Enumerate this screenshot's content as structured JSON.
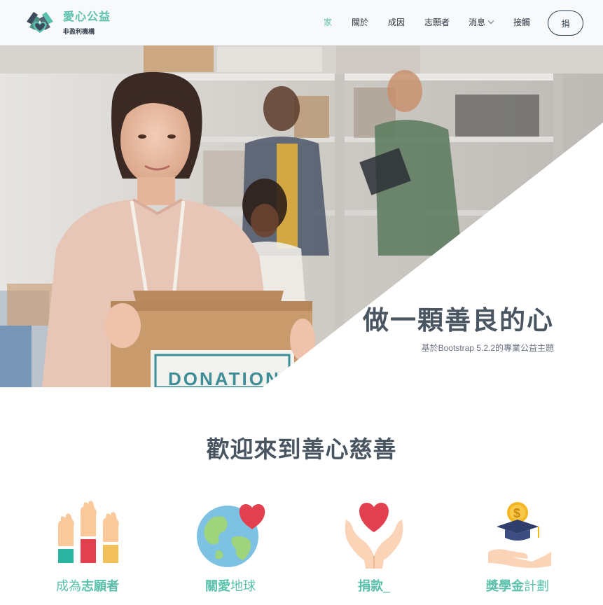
{
  "brand": {
    "title": "愛心公益",
    "subtitle": "非盈利機構",
    "logo_icon": "heart-hands-icon"
  },
  "nav": {
    "items": [
      {
        "label": "家",
        "active": true
      },
      {
        "label": "關於",
        "active": false
      },
      {
        "label": "成因",
        "active": false
      },
      {
        "label": "志願者",
        "active": false
      },
      {
        "label": "消息",
        "active": false,
        "dropdown": true
      },
      {
        "label": "接觸",
        "active": false
      }
    ],
    "donate_label": "捐"
  },
  "hero": {
    "title": "做一顆善良的心",
    "subtitle": "基於Bootstrap 5.2.2的專業公益主題",
    "box_text": "DONATION"
  },
  "welcome": {
    "title": "歡迎來到善心慈善"
  },
  "features": [
    {
      "icon": "raised-hands-icon",
      "bold": "志願者",
      "prefix": "成為",
      "suffix": ""
    },
    {
      "icon": "globe-heart-icon",
      "bold": "關愛",
      "prefix": "",
      "suffix": "地球"
    },
    {
      "icon": "heart-hands-icon",
      "bold": "捐款",
      "prefix": "",
      "suffix": "_"
    },
    {
      "icon": "scholarship-icon",
      "bold": "獎學金",
      "prefix": "",
      "suffix": "計劃"
    }
  ],
  "colors": {
    "accent": "#5bc1ac",
    "dark": "#4a5562",
    "heart": "#e2404f"
  }
}
